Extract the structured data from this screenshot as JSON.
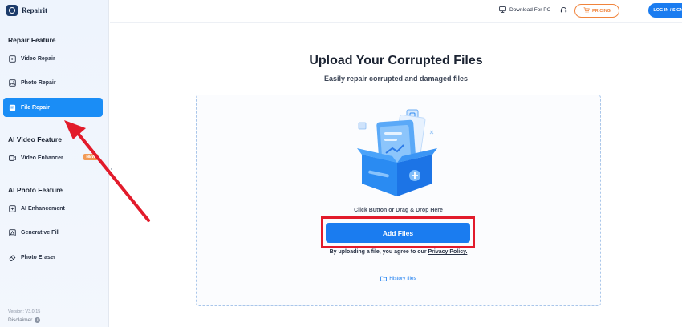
{
  "app": {
    "name": "Repairit"
  },
  "sidebar": {
    "sections": [
      {
        "title": "Repair Feature"
      },
      {
        "title": "AI Video Feature"
      },
      {
        "title": "AI Photo Feature"
      }
    ],
    "items": [
      {
        "label": "Video Repair",
        "icon": "play-icon"
      },
      {
        "label": "Photo Repair",
        "icon": "image-icon"
      },
      {
        "label": "File Repair",
        "icon": "file-icon",
        "active": true
      },
      {
        "label": "Video Enhancer",
        "icon": "video-enhance-icon",
        "badge": "NEW"
      },
      {
        "label": "AI Enhancement",
        "icon": "ai-sparkle-icon"
      },
      {
        "label": "Generative Fill",
        "icon": "fill-icon"
      },
      {
        "label": "Photo Eraser",
        "icon": "eraser-icon"
      }
    ],
    "version": "Version: V3.0.15",
    "disclaimer": "Disclaimer"
  },
  "header": {
    "download_label": "Download For PC",
    "pricing_label": "PRICING",
    "login_label": "LOG IN / SIGN UP"
  },
  "main": {
    "title": "Upload Your Corrupted Files",
    "subtitle": "Easily repair corrupted and damaged files",
    "drop_hint": "Click Button or Drag & Drop Here",
    "add_files_label": "Add Files",
    "agree_prefix": "By uploading a file, you agree to our",
    "privacy_link": "Privacy Policy.",
    "history_label": "History files"
  },
  "colors": {
    "accent": "#1a7cf0",
    "active_nav": "#1a8df6",
    "pricing": "#f0843c",
    "annotation": "#e21b2b"
  }
}
